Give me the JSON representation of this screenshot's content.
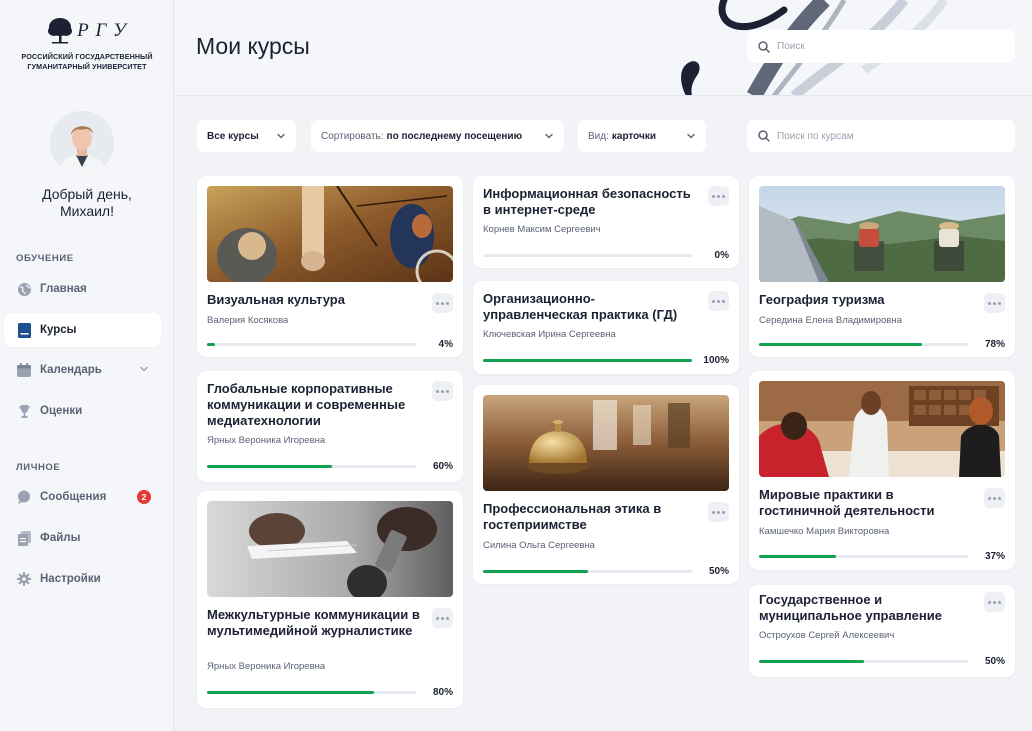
{
  "sidebar": {
    "logo_letters": "Р Г У",
    "university_line1": "РОССИЙСКИЙ ГОСУДАРСТВЕННЫЙ",
    "university_line2": "ГУМАНИТАРНЫЙ УНИВЕРСИТЕТ",
    "greeting_line1": "Добрый день,",
    "greeting_line2": "Михаил!",
    "sections": {
      "learning": "ОБУЧЕНИЕ",
      "personal": "ЛИЧНОЕ"
    },
    "items": [
      {
        "label": "Главная",
        "icon": "globe-icon"
      },
      {
        "label": "Курсы",
        "icon": "book-icon",
        "active": true
      },
      {
        "label": "Календарь",
        "icon": "calendar-icon"
      },
      {
        "label": "Оценки",
        "icon": "trophy-icon"
      },
      {
        "label": "Сообщения",
        "icon": "chat-icon",
        "badge": "2"
      },
      {
        "label": "Файлы",
        "icon": "files-icon"
      },
      {
        "label": "Настройки",
        "icon": "gear-icon"
      }
    ]
  },
  "header": {
    "title": "Мои курсы",
    "search_placeholder": "Поиск"
  },
  "filters": {
    "scope_value": "Все курсы",
    "sort_label": "Сортировать:",
    "sort_value": "по последнему посещению",
    "view_label": "Вид:",
    "view_value": "карточки",
    "course_search_placeholder": "Поиск по курсам"
  },
  "colors": {
    "accent_green": "#12a150",
    "badge_red": "#e53935",
    "text_dark": "#1c2233"
  },
  "courses": [
    {
      "title": "Визуальная культура",
      "author": "Валерия Косякова",
      "progress": 4,
      "progress_label": "4%",
      "image": "painting"
    },
    {
      "title": "Глобальные корпоративные коммуникации и современные медиатехнологии",
      "author": "Ярных Вероника Игоревна",
      "progress": 60,
      "progress_label": "60%"
    },
    {
      "title": "Межкультурные коммуникации в мультимедийной журналистике",
      "author": "Ярных Вероника Игоревна",
      "progress": 80,
      "progress_label": "80%",
      "image": "microphone"
    },
    {
      "title": "Информационная безопасность в интернет-среде",
      "author": "Корнев Максим Сергеевич",
      "progress": 0,
      "progress_label": "0%"
    },
    {
      "title": "Организационно-управленческая практика (ГД)",
      "author": "Ключевская Ирина Сергеевна",
      "progress": 100,
      "progress_label": "100%"
    },
    {
      "title": "Профессиональная этика в гостеприимстве",
      "author": "Силина Ольга Сергеевна",
      "progress": 50,
      "progress_label": "50%",
      "image": "service-bell"
    },
    {
      "title": "География туризма",
      "author": "Середина Елена Владимировна",
      "progress": 78,
      "progress_label": "78%",
      "image": "camping"
    },
    {
      "title": "Мировые практики в гостиничной деятельности",
      "author": "Камшечко Мария Викторовна",
      "progress": 37,
      "progress_label": "37%",
      "image": "hotel-reception"
    },
    {
      "title": "Государственное и муниципальное управление",
      "author": "Остроухов Сергей Алексеевич",
      "progress": 50,
      "progress_label": "50%"
    }
  ]
}
